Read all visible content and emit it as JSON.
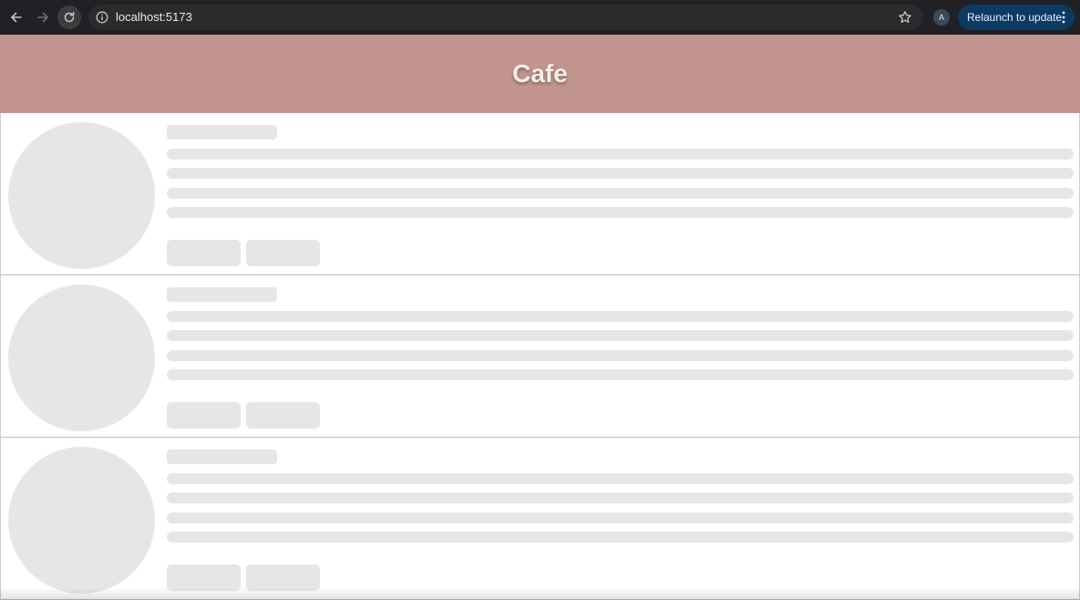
{
  "browser": {
    "url": "localhost:5173",
    "profile_initial": "A",
    "relaunch_label": "Relaunch to update",
    "icons": {
      "back": "arrow-left-icon",
      "forward": "arrow-right-icon",
      "reload": "reload-icon",
      "site_info": "info-icon",
      "bookmark": "star-icon",
      "menu": "kebab-menu-icon"
    }
  },
  "header": {
    "title": "Cafe",
    "background_color": "#c2948e"
  },
  "cards": [
    {
      "state": "loading-skeleton"
    },
    {
      "state": "loading-skeleton"
    },
    {
      "state": "loading-skeleton"
    }
  ]
}
